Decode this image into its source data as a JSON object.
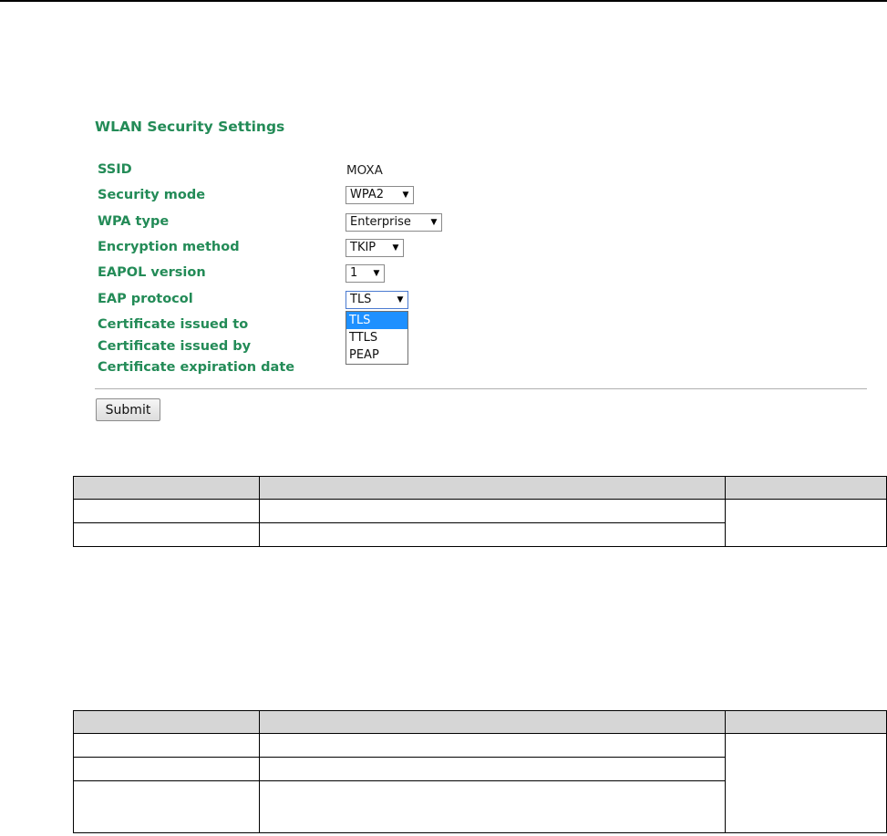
{
  "panel": {
    "title": "WLAN Security Settings",
    "fields": {
      "ssid": {
        "label": "SSID",
        "value": "MOXA"
      },
      "security_mode": {
        "label": "Security mode",
        "value": "WPA2"
      },
      "wpa_type": {
        "label": "WPA type",
        "value": "Enterprise"
      },
      "encryption_method": {
        "label": "Encryption method",
        "value": "TKIP"
      },
      "eapol_version": {
        "label": "EAPOL version",
        "value": "1"
      },
      "eap_protocol": {
        "label": "EAP protocol",
        "value": "TLS",
        "options": [
          "TLS",
          "TTLS",
          "PEAP"
        ]
      },
      "cert_issued_to": {
        "label": "Certificate issued to"
      },
      "cert_issued_by": {
        "label": "Certificate issued by"
      },
      "cert_expiration": {
        "label": "Certificate expiration date"
      }
    },
    "submit_label": "Submit"
  },
  "icons": {
    "select_arrow": "▼"
  },
  "colors": {
    "label_green": "#238b57",
    "selected_option": "#1e90ff",
    "table_header": "#d6d6d6"
  }
}
